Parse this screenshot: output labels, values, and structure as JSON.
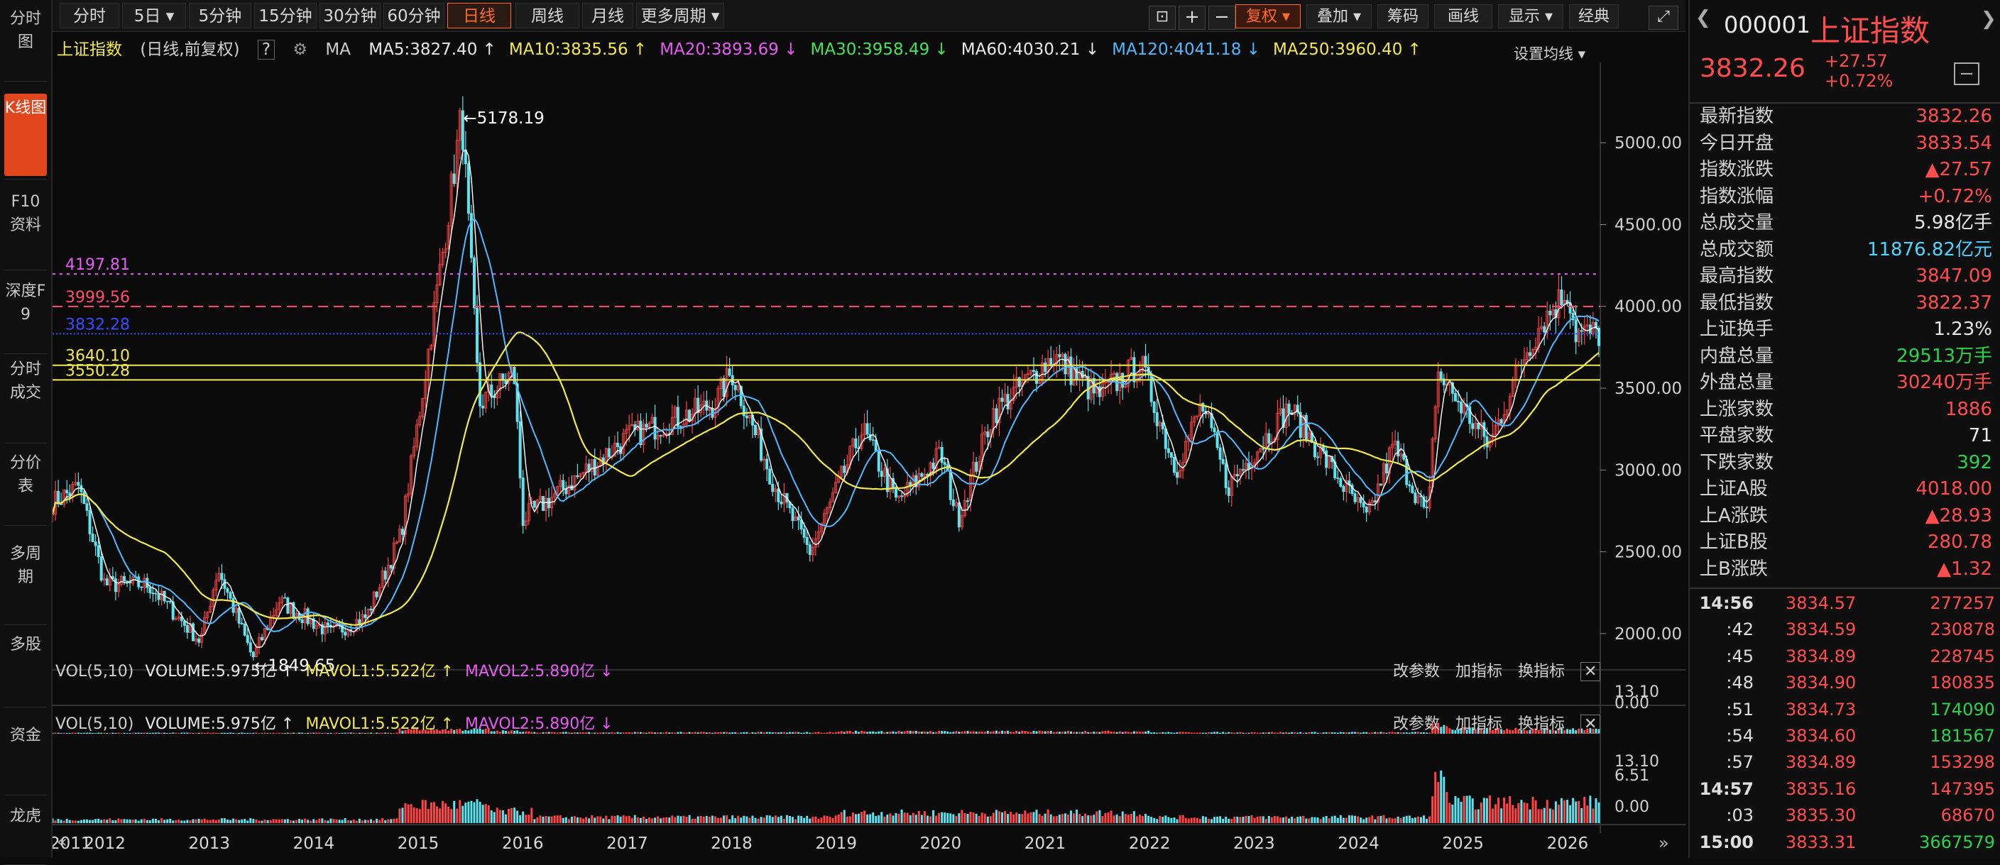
{
  "left_nav": [
    {
      "label": "分时图"
    },
    {
      "label": "K线图",
      "active": true
    },
    {
      "label": "F10资料"
    },
    {
      "label": "深度F9"
    },
    {
      "label": "分时成交"
    },
    {
      "label": "分价表"
    },
    {
      "label": "多周期"
    },
    {
      "label": "多股"
    },
    {
      "label": "资金"
    },
    {
      "label": "龙虎"
    }
  ],
  "toolbar": {
    "periods": [
      "分时",
      "5日 ▾",
      "5分钟",
      "15分钟",
      "30分钟",
      "60分钟",
      "日线",
      "周线",
      "月线",
      "更多周期 ▾"
    ],
    "active_period": "日线",
    "right_buttons": [
      "复权 ▾",
      "叠加 ▾",
      "筹码",
      "画线",
      "显示 ▾",
      "经典"
    ],
    "active_right": "复权 ▾"
  },
  "chart_header": {
    "name": "上证指数",
    "mode": "(日线,前复权)",
    "help": "?",
    "ma_label": "MA",
    "ma": [
      {
        "text": "MA5:3827.40 ↑",
        "color": "#e8e8e8"
      },
      {
        "text": "MA10:3835.56 ↑",
        "color": "#f2e94e"
      },
      {
        "text": "MA20:3893.69 ↓",
        "color": "#e65cf2"
      },
      {
        "text": "MA30:3958.49 ↓",
        "color": "#44e35a"
      },
      {
        "text": "MA60:4030.21 ↓",
        "color": "#e8e8e8"
      },
      {
        "text": "MA120:4041.18 ↓",
        "color": "#4fb8ff"
      },
      {
        "text": "MA250:3960.40 ↑",
        "color": "#f2e94e"
      }
    ],
    "settings": "设置均线 ▾"
  },
  "chart_data": {
    "type": "candlestick",
    "ylim": [
      1800,
      5300
    ],
    "y_ticks": [
      "5000.00",
      "4500.00",
      "4000.00",
      "3500.00",
      "3000.00",
      "2500.00",
      "2000.00"
    ],
    "x_labels": [
      "2011",
      "2012",
      "2013",
      "2014",
      "2015",
      "2016",
      "2017",
      "2018",
      "2019",
      "2020",
      "2021",
      "2022",
      "2023",
      "2024",
      "2025",
      "2026"
    ],
    "series": [
      {
        "x": [
          "2011-07",
          "2011-10",
          "2012-01",
          "2012-06",
          "2012-12",
          "2013-02",
          "2013-06",
          "2013-09",
          "2014-03",
          "2014-07",
          "2014-11",
          "2015-01",
          "2015-04",
          "2015-06",
          "2015-08",
          "2015-12",
          "2016-01",
          "2016-06",
          "2017-01",
          "2017-11",
          "2018-01",
          "2018-06",
          "2018-10",
          "2019-04",
          "2019-08",
          "2020-01",
          "2020-03",
          "2020-07",
          "2021-02",
          "2021-07",
          "2021-12",
          "2022-04",
          "2022-07",
          "2022-10",
          "2023-05",
          "2023-10",
          "2024-02",
          "2024-05",
          "2024-09",
          "2024-10",
          "2025-04",
          "2025-08",
          "2025-10",
          "2026-01",
          "2026-02"
        ],
        "y": [
          2800,
          2900,
          2300,
          2300,
          1950,
          2400,
          1849.65,
          2200,
          2000,
          2100,
          2600,
          3300,
          4400,
          5178.19,
          3400,
          3600,
          2700,
          2900,
          3200,
          3400,
          3600,
          2900,
          2500,
          3250,
          2800,
          3100,
          2700,
          3350,
          3700,
          3450,
          3650,
          3000,
          3400,
          2900,
          3380,
          3000,
          2700,
          3150,
          2700,
          3600,
          3150,
          3700,
          3900,
          4100,
          3832
        ]
      },
      {
        "name": "4197.81",
        "value": 4197.81,
        "color": "#e65cf2",
        "dash": "4 6"
      },
      {
        "name": "3999.56",
        "value": 3999.56,
        "color": "#ff4d6a",
        "dash": "14 8"
      },
      {
        "name": "3832.28",
        "value": 3832.28,
        "color": "#3a4bff",
        "dash": "2 3"
      },
      {
        "name": "3640.10",
        "value": 3640.1,
        "color": "#f2e94e"
      },
      {
        "name": "3550.28",
        "value": 3550.28,
        "color": "#f2e94e"
      }
    ],
    "annotations": [
      {
        "text": "←5178.19",
        "x": "2015-06",
        "y": 5178.19
      },
      {
        "text": "←1849.65",
        "x": "2013-06",
        "y": 1849.65
      }
    ]
  },
  "hlines": [
    {
      "label": "4197.81",
      "value": 4197.81,
      "color": "#e65cf2"
    },
    {
      "label": "3999.56",
      "value": 3999.56,
      "color": "#ff4d6a"
    },
    {
      "label": "3832.28",
      "value": 3832.28,
      "color": "#3a4bff"
    },
    {
      "label": "3640.10",
      "value": 3640.1,
      "color": "#f2e94e"
    },
    {
      "label": "3550.28",
      "value": 3550.28,
      "color": "#f2e94e"
    }
  ],
  "vol1": {
    "head": [
      {
        "text": "VOL(5,10)",
        "color": "#cfcfcf"
      },
      {
        "text": "VOLUME:5.975亿 ↑",
        "color": "#e8e8e8"
      },
      {
        "text": "MAVOL1:5.522亿 ↑",
        "color": "#f2e94e"
      },
      {
        "text": "MAVOL2:5.890亿 ↓",
        "color": "#e65cf2"
      }
    ],
    "tools": [
      "改参数",
      "加指标",
      "换指标"
    ],
    "ticks": [
      "13.10",
      "0.00"
    ]
  },
  "vol2": {
    "head": [
      {
        "text": "VOL(5,10)",
        "color": "#cfcfcf"
      },
      {
        "text": "VOLUME:5.975亿 ↑",
        "color": "#e8e8e8"
      },
      {
        "text": "MAVOL1:5.522亿 ↑",
        "color": "#f2e94e"
      },
      {
        "text": "MAVOL2:5.890亿 ↓",
        "color": "#e65cf2"
      }
    ],
    "tools": [
      "改参数",
      "加指标",
      "换指标"
    ],
    "ticks": [
      "13.10",
      "6.51",
      "0.00"
    ]
  },
  "quote": {
    "code": "000001",
    "name": "上证指数",
    "price": "3832.26",
    "change": "+27.57",
    "pct": "+0.72%",
    "rows": [
      {
        "label": "最新指数",
        "value": "3832.26",
        "cls": "red"
      },
      {
        "label": "今日开盘",
        "value": "3833.54",
        "cls": "red"
      },
      {
        "label": "指数涨跌",
        "value": "▲27.57",
        "cls": "red"
      },
      {
        "label": "指数涨幅",
        "value": "+0.72%",
        "cls": "red"
      },
      {
        "label": "总成交量",
        "value": "5.98亿手",
        "cls": "white"
      },
      {
        "label": "总成交额",
        "value": "11876.82亿元",
        "cls": "cyan"
      },
      {
        "label": "最高指数",
        "value": "3847.09",
        "cls": "red"
      },
      {
        "label": "最低指数",
        "value": "3822.37",
        "cls": "red"
      },
      {
        "label": "上证换手",
        "value": "1.23%",
        "cls": "white"
      },
      {
        "label": "内盘总量",
        "value": "29513万手",
        "cls": "green"
      },
      {
        "label": "外盘总量",
        "value": "30240万手",
        "cls": "red"
      },
      {
        "label": "上涨家数",
        "value": "1886",
        "cls": "red"
      },
      {
        "label": "平盘家数",
        "value": "71",
        "cls": "white"
      },
      {
        "label": "下跌家数",
        "value": "392",
        "cls": "green"
      },
      {
        "label": "上证A股",
        "value": "4018.00",
        "cls": "red"
      },
      {
        "label": "上A涨跌",
        "value": "▲28.93",
        "cls": "red"
      },
      {
        "label": "上证B股",
        "value": "280.78",
        "cls": "red"
      },
      {
        "label": "上B涨跌",
        "value": "▲1.32",
        "cls": "red"
      }
    ],
    "ticks": [
      {
        "t": "14:56",
        "p": "3834.57",
        "v": "277257",
        "vc": "red"
      },
      {
        "t": ":42",
        "p": "3834.59",
        "v": "230878",
        "vc": "red"
      },
      {
        "t": ":45",
        "p": "3834.89",
        "v": "228745",
        "vc": "red"
      },
      {
        "t": ":48",
        "p": "3834.90",
        "v": "180835",
        "vc": "red"
      },
      {
        "t": ":51",
        "p": "3834.73",
        "v": "174090",
        "vc": "green"
      },
      {
        "t": ":54",
        "p": "3834.60",
        "v": "181567",
        "vc": "green"
      },
      {
        "t": ":57",
        "p": "3834.89",
        "v": "153298",
        "vc": "red"
      },
      {
        "t": "14:57",
        "p": "3835.16",
        "v": "147395",
        "vc": "red"
      },
      {
        "t": ":03",
        "p": "3835.30",
        "v": "68670",
        "vc": "red"
      },
      {
        "t": "15:00",
        "p": "3833.31",
        "v": "3667579",
        "vc": "green"
      }
    ]
  }
}
